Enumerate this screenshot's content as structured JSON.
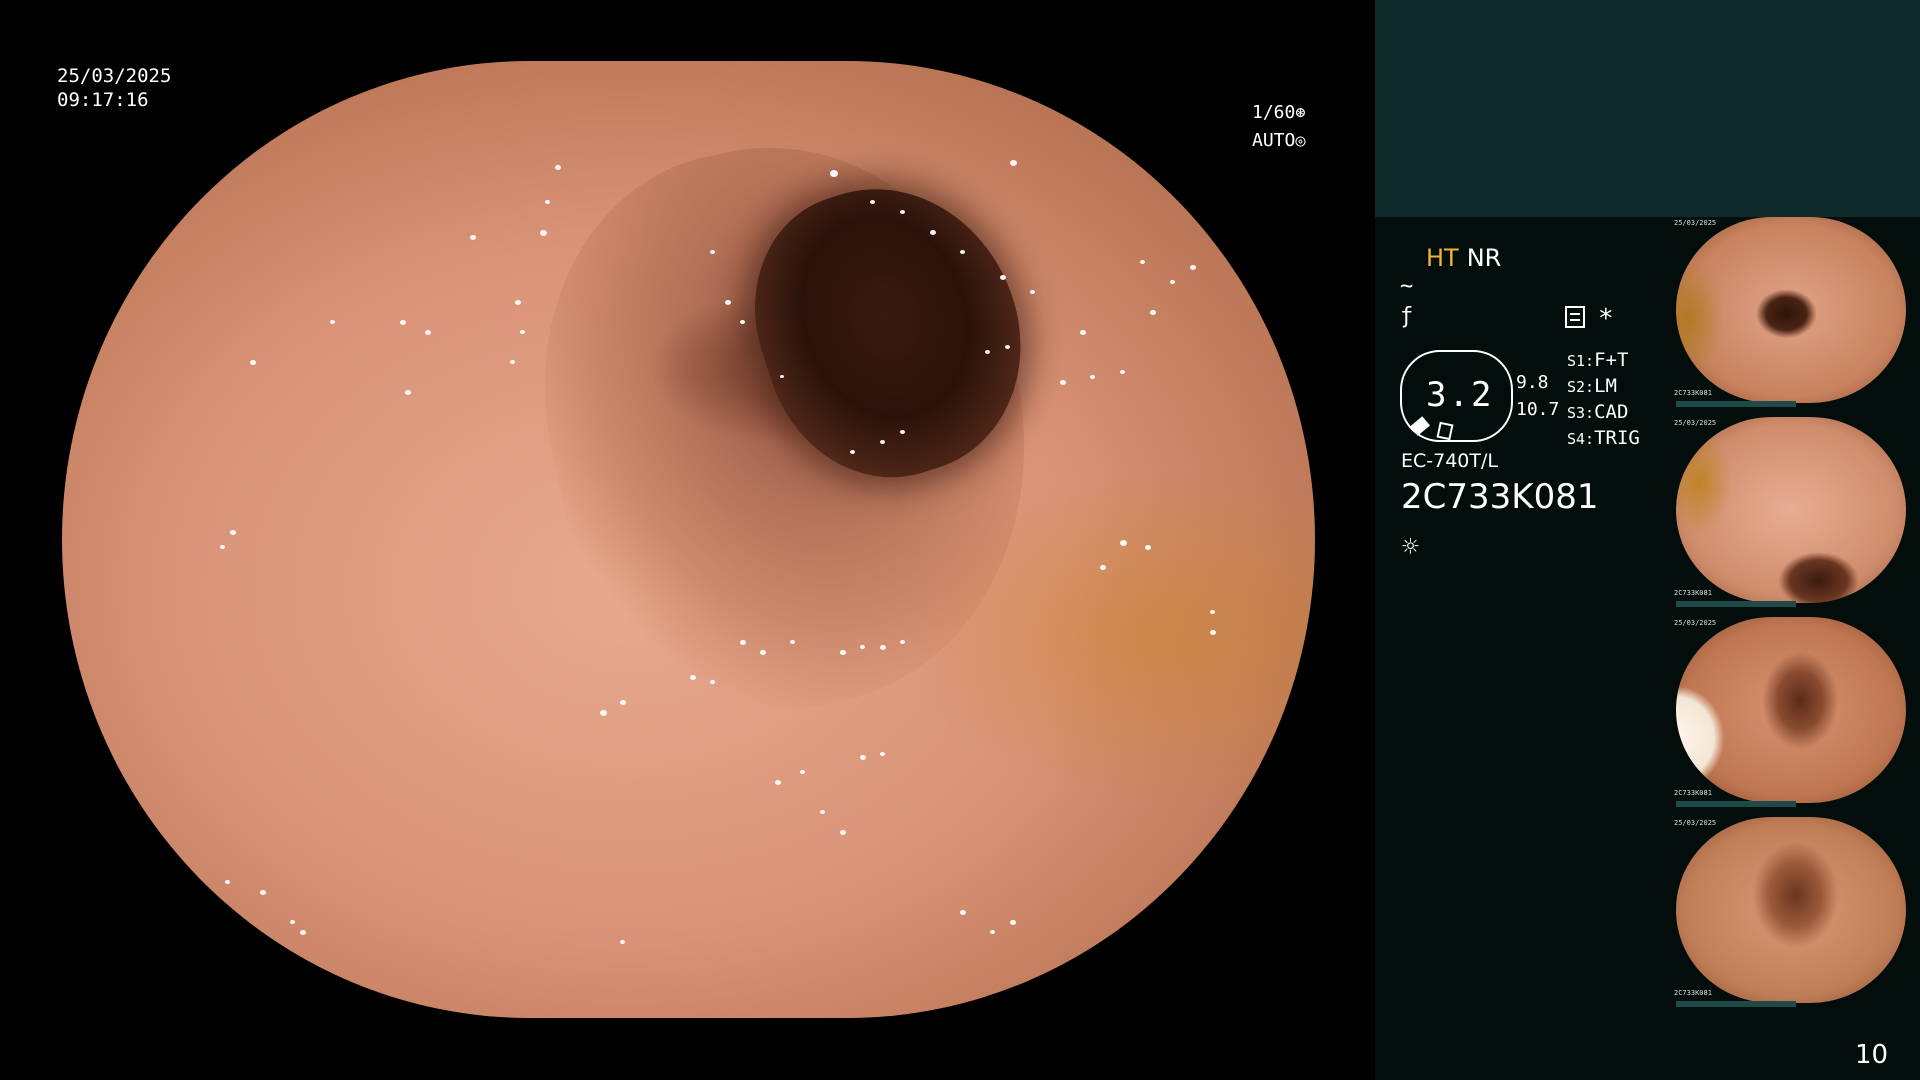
{
  "overlay": {
    "date": "25/03/2025",
    "time": "09:17:16",
    "shutter": "1/60",
    "shutter_icon": "aperture-icon",
    "iris": "AUTO",
    "iris_icon": "iris-icon"
  },
  "panel": {
    "ht_label": "HT",
    "nr_label": "NR",
    "ht_color": "#f2b531",
    "gauge_value": "3.2",
    "gauge_upper": "9.8",
    "gauge_lower": "10.7",
    "settings": [
      {
        "key": "S1:",
        "value": "F+T"
      },
      {
        "key": "S2:",
        "value": "LM"
      },
      {
        "key": "S3:",
        "value": "CAD"
      },
      {
        "key": "S4:",
        "value": "TRIG"
      }
    ],
    "asterisk": "*",
    "model": "EC-740T/L",
    "serial": "2C733K081",
    "sun_glyph": "☼",
    "bg_color": "#030d0c",
    "top_color": "#0f2a2a"
  },
  "thumbnails": [
    {
      "stamp_date": "25/03/2025",
      "stamp_serial": "2C733K081"
    },
    {
      "stamp_date": "25/03/2025",
      "stamp_serial": "2C733K081"
    },
    {
      "stamp_date": "25/03/2025",
      "stamp_serial": "2C733K081"
    },
    {
      "stamp_date": "25/03/2025",
      "stamp_serial": "2C733K081"
    }
  ],
  "page_number": "10"
}
